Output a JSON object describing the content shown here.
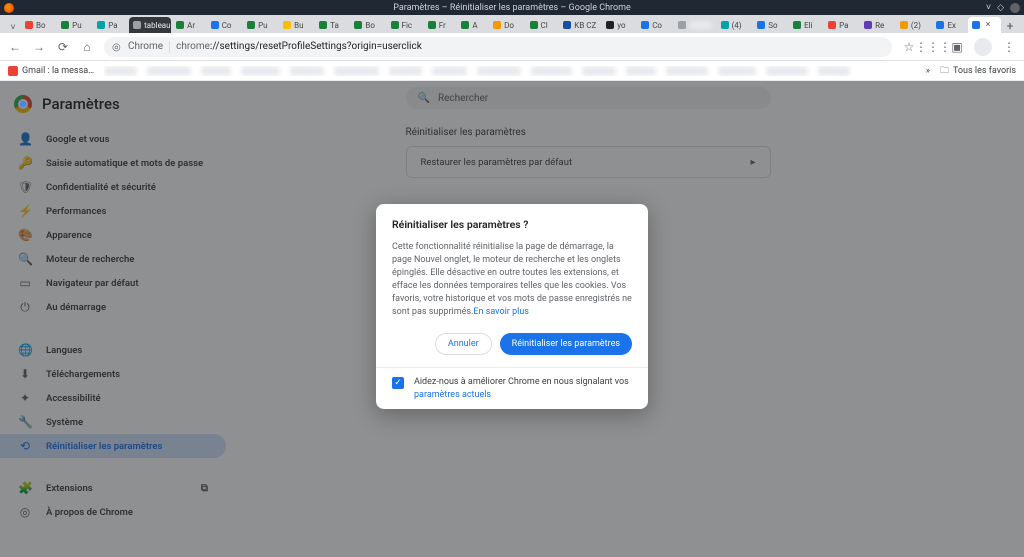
{
  "os_title": "Paramètres – Réinitialiser les paramètres – Google Chrome",
  "url_prefix": "chrome",
  "url_path": "://settings/resetProfileSettings?origin=userclick",
  "tabs": [
    {
      "fc": "fc-red",
      "label": "Bo"
    },
    {
      "fc": "fc-green",
      "label": "Pu"
    },
    {
      "fc": "fc-teal",
      "label": "Pa"
    },
    {
      "fc": "fc-gray",
      "label": "tableau google",
      "hovered": true
    },
    {
      "fc": "fc-green",
      "label": "Ar"
    },
    {
      "fc": "fc-blue",
      "label": "Co"
    },
    {
      "fc": "fc-green",
      "label": "Pu"
    },
    {
      "fc": "fc-yellow",
      "label": "Bu"
    },
    {
      "fc": "fc-green",
      "label": "Ta"
    },
    {
      "fc": "fc-green",
      "label": "Bo"
    },
    {
      "fc": "fc-green",
      "label": "Fic"
    },
    {
      "fc": "fc-green",
      "label": "Fr"
    },
    {
      "fc": "fc-green",
      "label": "A"
    },
    {
      "fc": "fc-orange",
      "label": "Do"
    },
    {
      "fc": "fc-green",
      "label": "Cl"
    },
    {
      "fc": "fc-dkblue",
      "label": "KB CZ"
    },
    {
      "fc": "fc-black",
      "label": "yo"
    },
    {
      "fc": "fc-blue",
      "label": "Co"
    },
    {
      "fc": "fc-gray",
      "label": "",
      "blur": true
    },
    {
      "fc": "fc-teal",
      "label": "(4)"
    },
    {
      "fc": "fc-blue",
      "label": "So"
    },
    {
      "fc": "fc-green",
      "label": "Eli"
    },
    {
      "fc": "fc-red",
      "label": "Pa"
    },
    {
      "fc": "fc-purple",
      "label": "Re"
    },
    {
      "fc": "fc-orange",
      "label": "(2)"
    },
    {
      "fc": "fc-blue",
      "label": "Ex"
    },
    {
      "fc": "fc-blue",
      "label": "",
      "active": true,
      "close": true
    }
  ],
  "bookmarks": {
    "first": {
      "fc": "fc-red",
      "label": "Gmail : la messa…"
    },
    "overflow": "»",
    "all": "Tous les favoris"
  },
  "settings_title": "Paramètres",
  "sidebar": [
    {
      "icon": "👤",
      "label": "Google et vous"
    },
    {
      "icon": "🔑",
      "label": "Saisie automatique et mots de passe"
    },
    {
      "icon": "🛡",
      "label": "Confidentialité et sécurité"
    },
    {
      "icon": "⚡",
      "label": "Performances"
    },
    {
      "icon": "🎨",
      "label": "Apparence"
    },
    {
      "icon": "🔍",
      "label": "Moteur de recherche"
    },
    {
      "icon": "▭",
      "label": "Navigateur par défaut"
    },
    {
      "icon": "⏻",
      "label": "Au démarrage"
    }
  ],
  "sidebar2": [
    {
      "icon": "🌐",
      "label": "Langues"
    },
    {
      "icon": "⬇",
      "label": "Téléchargements"
    },
    {
      "icon": "✦",
      "label": "Accessibilité"
    },
    {
      "icon": "🔧",
      "label": "Système"
    },
    {
      "icon": "⟲",
      "label": "Réinitialiser les paramètres",
      "sel": true
    }
  ],
  "sidebar3": [
    {
      "icon": "🧩",
      "label": "Extensions",
      "ext": true
    },
    {
      "icon": "◎",
      "label": "À propos de Chrome"
    }
  ],
  "search_placeholder": "Rechercher",
  "section_heading": "Réinitialiser les paramètres",
  "reset_row_label": "Restaurer les paramètres par défaut",
  "dialog": {
    "title": "Réinitialiser les paramètres ?",
    "body": "Cette fonctionnalité réinitialise la page de démarrage, la page Nouvel onglet, le moteur de recherche et les onglets épinglés. Elle désactive en outre toutes les extensions, et efface les données temporaires telles que les cookies. Vos favoris, votre historique et vos mots de passe enregistrés ne sont pas supprimés.",
    "learn_more": "En savoir plus",
    "cancel": "Annuler",
    "confirm": "Réinitialiser les paramètres",
    "footer_text": "Aidez-nous à améliorer Chrome en nous signalant vos ",
    "footer_link": "paramètres actuels"
  }
}
